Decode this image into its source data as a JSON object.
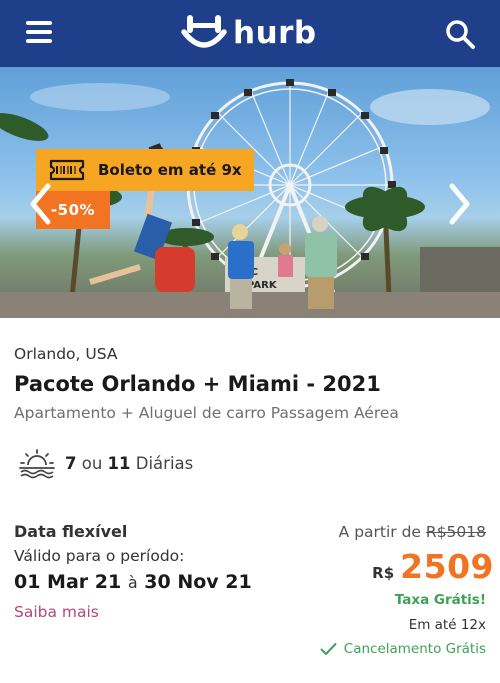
{
  "header": {
    "menu_icon": "hamburger-menu-icon",
    "brand": "hurb",
    "search_icon": "search-icon",
    "bg_color": "#1f3f8a"
  },
  "hero": {
    "installment_badge": "Boleto em até 9x",
    "installment_icon": "ticket-icon",
    "discount_badge": "-50%",
    "prev_icon": "chevron-left-icon",
    "next_icon": "chevron-right-icon",
    "ferris_sign": "ICON PARK"
  },
  "package": {
    "location": "Orlando, USA",
    "title": "Pacote Orlando + Miami - 2021",
    "subtitle": "Apartamento + Aluguel de carro Passagem Aérea",
    "nights_a": "7",
    "nights_or": "ou",
    "nights_b": "11",
    "nights_label": "Diárias"
  },
  "validity": {
    "flex_label": "Data flexível",
    "period_label": "Válido para o período:",
    "start": "01 Mar 21",
    "to": "à",
    "end": "30 Nov 21",
    "more_link": "Saiba mais"
  },
  "pricing": {
    "from_label": "A partir de",
    "old_price": "R$5018",
    "currency": "R$",
    "price": "2509",
    "free_fee": "Taxa Grátis!",
    "installments": "Em até 12x",
    "cancellation": "Cancelamento Grátis",
    "accent": "#f27321",
    "green": "#3fa05a"
  }
}
